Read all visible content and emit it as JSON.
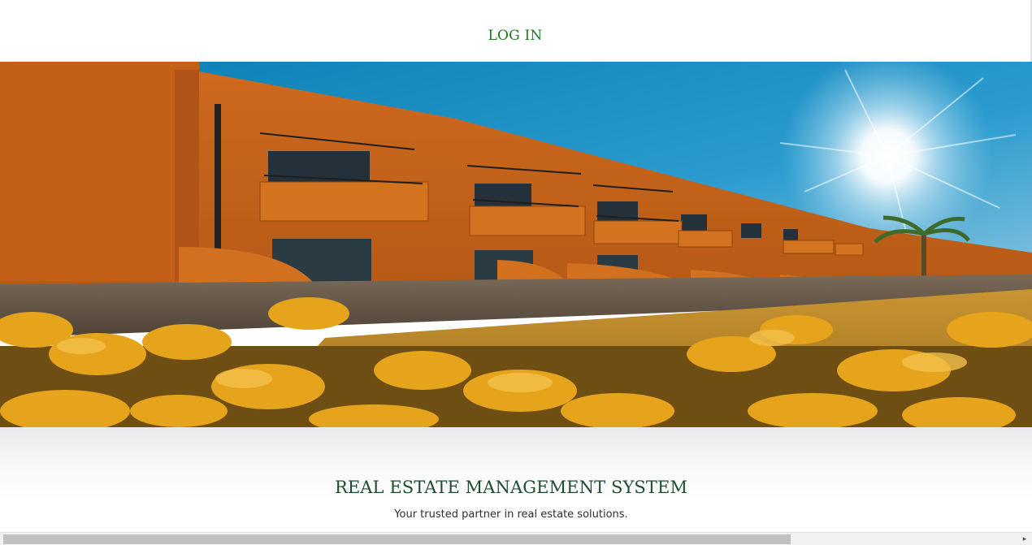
{
  "header": {
    "login_label": "LOG IN"
  },
  "hero": {
    "image_description_icon": "building-photo",
    "colors": {
      "sky": "#1f8fc4",
      "building": "#c8641c",
      "foliage": "#e7a21f",
      "wall": "#6a5a4a"
    }
  },
  "site": {
    "title": "REAL ESTATE MANAGEMENT SYSTEM",
    "tagline": "Your trusted partner in real estate solutions."
  },
  "scrollbar": {
    "arrow_glyph": "▸"
  }
}
